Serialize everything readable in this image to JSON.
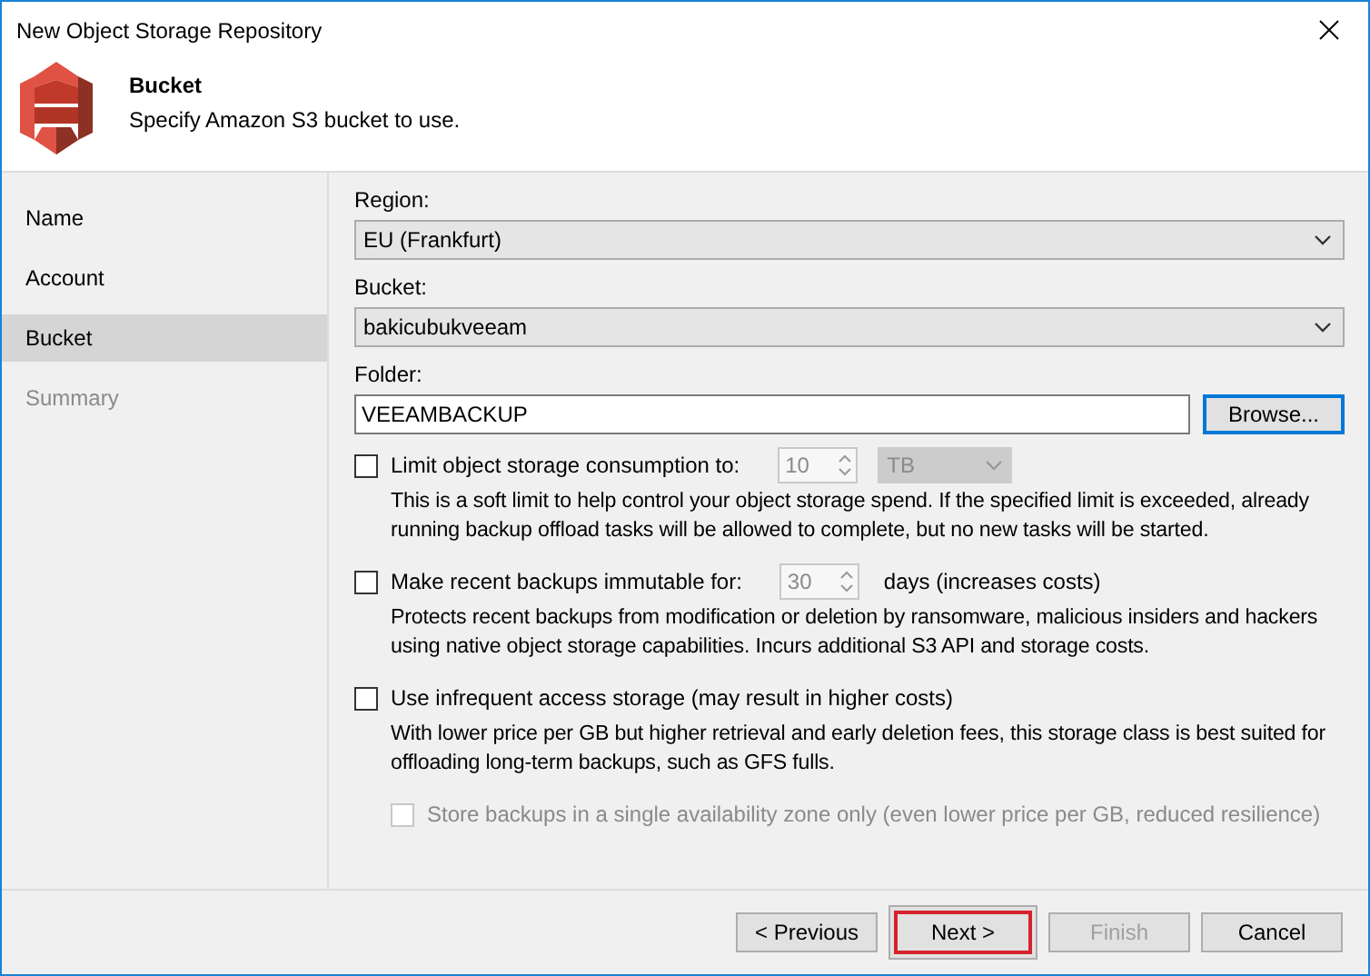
{
  "window": {
    "title": "New Object Storage Repository"
  },
  "header": {
    "title": "Bucket",
    "subtitle": "Specify Amazon S3 bucket to use."
  },
  "steps": [
    {
      "label": "Name",
      "selected": false,
      "disabled": false
    },
    {
      "label": "Account",
      "selected": false,
      "disabled": false
    },
    {
      "label": "Bucket",
      "selected": true,
      "disabled": false
    },
    {
      "label": "Summary",
      "selected": false,
      "disabled": true
    }
  ],
  "region": {
    "label": "Region:",
    "value": "EU (Frankfurt)"
  },
  "bucket": {
    "label": "Bucket:",
    "value": "bakicubukveeam"
  },
  "folder": {
    "label": "Folder:",
    "value": "VEEAMBACKUP",
    "button": "Browse..."
  },
  "options": [
    {
      "kind": "limit",
      "label": "Limit object storage consumption to:",
      "checked": false,
      "number": "10",
      "unit": "TB",
      "description": "This is a soft limit to help control your object storage spend. If the specified limit is exceeded, already running backup offload tasks will be allowed to complete, but no new tasks will be started."
    },
    {
      "kind": "immutable",
      "label": "Make recent backups immutable for:",
      "checked": false,
      "number": "30",
      "suffix": "days (increases costs)",
      "description": "Protects recent backups from modification or deletion by ransomware, malicious insiders and hackers using native object storage capabilities. Incurs additional S3 API and storage costs."
    },
    {
      "kind": "plain",
      "label": "Use infrequent access storage (may result in higher costs)",
      "checked": false,
      "description": "With lower price per GB but higher retrieval and early deletion fees, this storage class is best suited for offloading long-term backups, such as GFS fulls."
    },
    {
      "kind": "sub",
      "label": "Store backups in a single availability zone only (even lower price per GB, reduced resilience)",
      "checked": false,
      "disabled": true
    }
  ],
  "buttons": [
    {
      "label": "< Previous",
      "disabled": false,
      "highlighted": false
    },
    {
      "label": "Next >",
      "disabled": false,
      "highlighted": true
    },
    {
      "label": "Finish",
      "disabled": true,
      "highlighted": false
    },
    {
      "label": "Cancel",
      "disabled": false,
      "highlighted": false
    }
  ]
}
